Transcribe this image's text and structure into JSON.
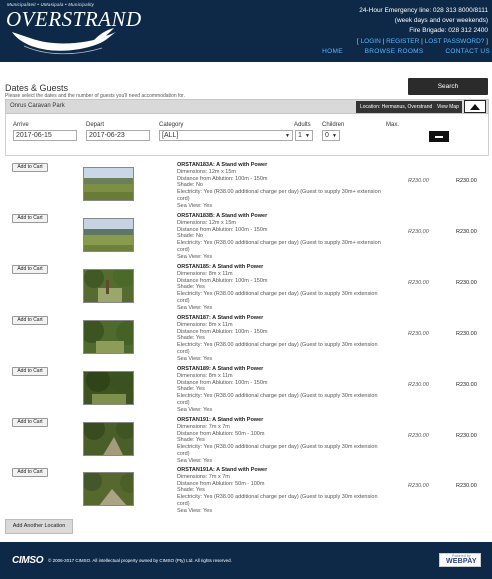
{
  "header": {
    "tagline": "Municipaliteit • UMasipala • Municipality",
    "logo_text": "OVERSTRAND",
    "contact": {
      "line1": "24-Hour Emergency line: 028 313 8000/8111",
      "line2": "(week days and over weekends)",
      "line3": "Fire Brigade: 028 312 2400"
    },
    "links": {
      "login": "LOGIN",
      "register": "REGISTER",
      "lost_password": "LOST PASSWORD?"
    },
    "nav": [
      "HOME",
      "BROWSE ROOMS",
      "CONTACT US"
    ]
  },
  "search": {
    "title": "Dates & Guests",
    "subtitle": "Please select the dates and the number of guests you'll need accommodation for.",
    "button": "Search"
  },
  "location": {
    "park_name": "Onrus Caravan Park",
    "location_button": "Location: Hermanus, Overstrand",
    "map_button": "View Map"
  },
  "filters": {
    "arrive_label": "Arrive",
    "arrive_value": "2017-06-15",
    "depart_label": "Depart",
    "depart_value": "2017-06-23",
    "category_label": "Category",
    "category_value": "[ALL]",
    "adults_label": "Adults",
    "adults_value": "1",
    "children_label": "Children",
    "children_value": "0",
    "max_label": "Max."
  },
  "results": [
    {
      "add_label": "Add to Cart",
      "title": "ORSTAN183A: A Stand with Power",
      "dimensions": "Dimensions: 12m x 15m",
      "distance": "Distance from Ablution: 100m - 150m",
      "shade": "Shade: No",
      "electricity": "Electricity: Yes (R38.00 additional charge per day) (Guest to supply 30m+ extension cord)",
      "sea_view": "Sea View: Yes",
      "price_italic": "R230.00",
      "price": "R230.00"
    },
    {
      "add_label": "Add to Cart",
      "title": "ORSTAN183B: A Stand with Power",
      "dimensions": "Dimensions: 12m x 15m",
      "distance": "Distance from Ablution: 100m - 150m",
      "shade": "Shade: No",
      "electricity": "Electricity: Yes (R38.00 additional charge per day) (Guest to supply 30m+ extension cord)",
      "sea_view": "Sea View: Yes",
      "price_italic": "R230.00",
      "price": "R230.00"
    },
    {
      "add_label": "Add to Cart",
      "title": "ORSTAN185: A Stand with Power",
      "dimensions": "Dimensions: 8m x 11m",
      "distance": "Distance from Ablution: 100m - 150m",
      "shade": "Shade: Yes",
      "electricity": "Electricity: Yes (R38.00 additional charge per day) (Guest to supply 30m extension cord)",
      "sea_view": "Sea View: Yes",
      "price_italic": "R230.00",
      "price": "R230.00"
    },
    {
      "add_label": "Add to Cart",
      "title": "ORSTAN187: A Stand with Power",
      "dimensions": "Dimensions: 8m x 11m",
      "distance": "Distance from Ablution: 100m - 150m",
      "shade": "Shade: Yes",
      "electricity": "Electricity: Yes (R38.00 additional charge per day) (Guest to supply 30m extension cord)",
      "sea_view": "Sea View: Yes",
      "price_italic": "R230.00",
      "price": "R230.00"
    },
    {
      "add_label": "Add to Cart",
      "title": "ORSTAN189: A Stand with Power",
      "dimensions": "Dimensions: 8m x 11m",
      "distance": "Distance from Ablution: 100m - 150m",
      "shade": "Shade: Yes",
      "electricity": "Electricity: Yes (R38.00 additional charge per day) (Guest to supply 30m extension cord)",
      "sea_view": "Sea View: Yes",
      "price_italic": "R230.00",
      "price": "R230.00"
    },
    {
      "add_label": "Add to Cart",
      "title": "ORSTAN191: A Stand with Power",
      "dimensions": "Dimensions: 7m x 7m",
      "distance": "Distance from Ablution: 50m - 100m",
      "shade": "Shade: Yes",
      "electricity": "Electricity: Yes (R38.00 additional charge per day) (Guest to supply 30m extension cord)",
      "sea_view": "Sea View: Yes",
      "price_italic": "R230.00",
      "price": "R230.00"
    },
    {
      "add_label": "Add to Cart",
      "title": "ORSTAN191A: A Stand with Power",
      "dimensions": "Dimensions: 7m x 7m",
      "distance": "Distance from Ablution: 50m - 100m",
      "shade": "Shade: Yes",
      "electricity": "Electricity: Yes (R38.00 additional charge per day) (Guest to supply 30m extension cord)",
      "sea_view": "Sea View: Yes",
      "price_italic": "R230.00",
      "price": "R230.00"
    }
  ],
  "add_location_button": "Add Another Location",
  "footer": {
    "brand": "CIMSO",
    "copyright": "© 2006-2017 CIMSO. All intellectual property owned by CIMSO (Pty) Ltd. All rights reserved.",
    "payment_logo": "WEBPAY",
    "payment_powered": "Powered by"
  },
  "colors": {
    "header_bg": "#0d2947",
    "link": "#5ab4ff",
    "dark_button": "#2b2b2b"
  }
}
